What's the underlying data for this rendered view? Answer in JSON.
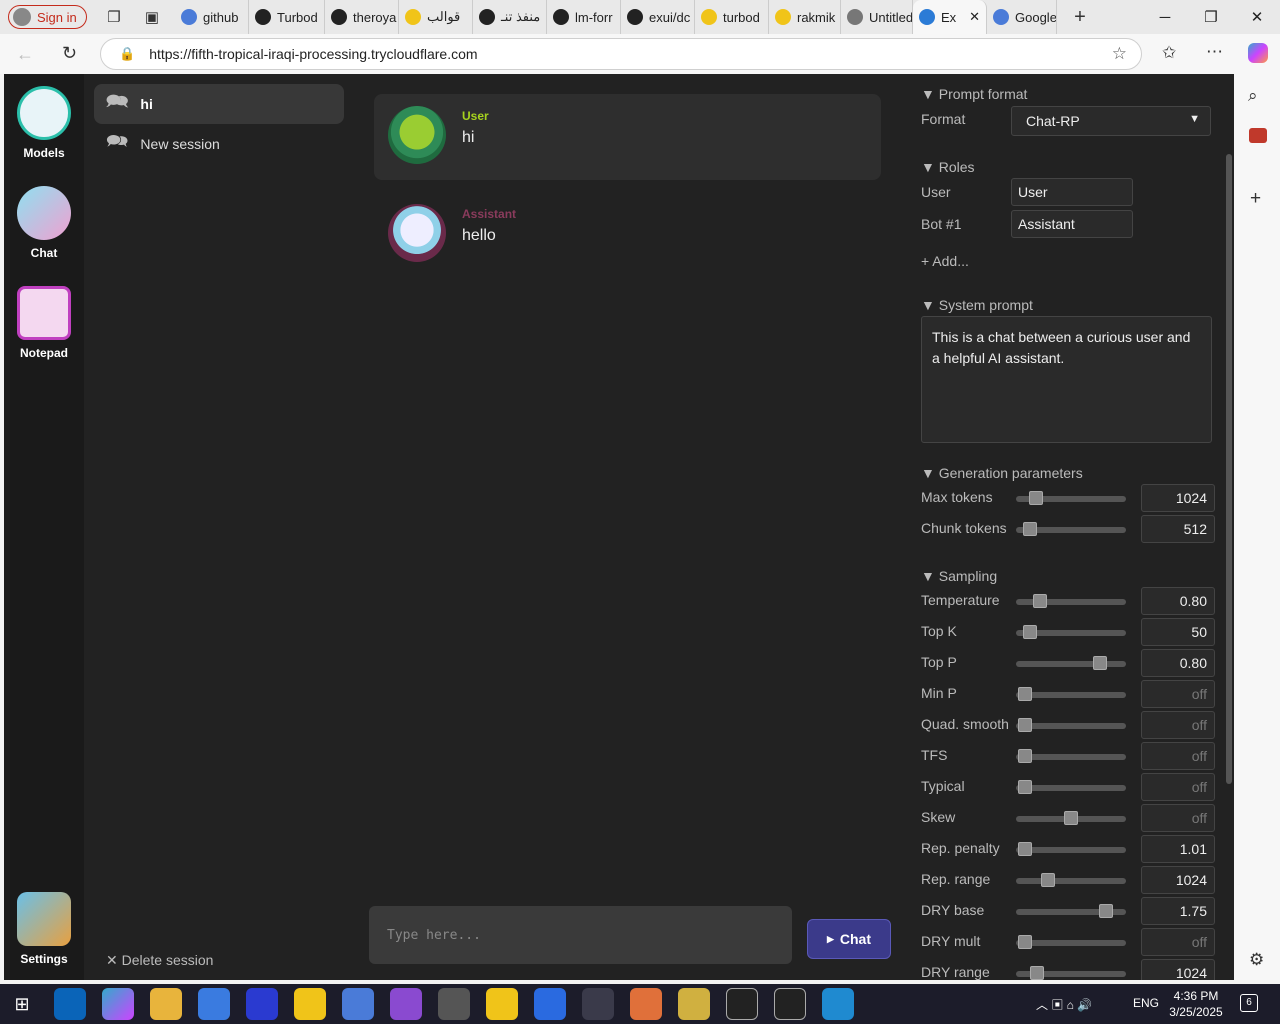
{
  "browser": {
    "signin": "Sign in",
    "tabs": [
      {
        "label": "github",
        "color": "#4a7bd8"
      },
      {
        "label": "Turbod",
        "color": "#222"
      },
      {
        "label": "theroya",
        "color": "#222"
      },
      {
        "label": "قوالب",
        "color": "#f0c419"
      },
      {
        "label": "منفذ تنـ",
        "color": "#222"
      },
      {
        "label": "lm-forr",
        "color": "#222"
      },
      {
        "label": "exui/dc",
        "color": "#222"
      },
      {
        "label": "turbod",
        "color": "#f0c419"
      },
      {
        "label": "rakmik",
        "color": "#f0c419"
      },
      {
        "label": "Untitled",
        "color": "#777"
      },
      {
        "label": "Ex",
        "color": "#2b7bd6",
        "active": true
      },
      {
        "label": "Google",
        "color": "#4a7bd8"
      }
    ],
    "url": "https://fifth-tropical-iraqi-processing.trycloudflare.com"
  },
  "rail": {
    "models": "Models",
    "chat": "Chat",
    "notepad": "Notepad",
    "settings": "Settings"
  },
  "sessions": {
    "items": [
      "hi",
      "New session"
    ],
    "delete": "✕ Delete session"
  },
  "chat": {
    "messages": [
      {
        "role": "User",
        "text": "hi",
        "color": "#a6d21e"
      },
      {
        "role": "Assistant",
        "text": "hello",
        "color": "#8a3b5c"
      }
    ],
    "placeholder": "Type here...",
    "send": "Chat"
  },
  "panel": {
    "prompt_format_title": "▼ Prompt format",
    "format_label": "Format",
    "format_value": "Chat-RP",
    "roles_title": "▼ Roles",
    "role_user_label": "User",
    "role_user_value": "User",
    "role_bot_label": "Bot #1",
    "role_bot_value": "Assistant",
    "add": "+ Add...",
    "system_title": "▼ System prompt",
    "system_text": "This is a chat between a curious user and a helpful AI assistant.",
    "gen_title": "▼ Generation parameters",
    "gen": [
      {
        "label": "Max tokens",
        "value": "1024",
        "level": 0.18
      },
      {
        "label": "Chunk tokens",
        "value": "512",
        "level": 0.13
      }
    ],
    "sampling_title": "▼ Sampling",
    "sampling": [
      {
        "label": "Temperature",
        "value": "0.80",
        "level": 0.22
      },
      {
        "label": "Top K",
        "value": "50",
        "level": 0.13
      },
      {
        "label": "Top P",
        "value": "0.80",
        "level": 0.76
      },
      {
        "label": "Min P",
        "value": "off",
        "level": 0.08
      },
      {
        "label": "Quad. smooth",
        "value": "off",
        "level": 0.08
      },
      {
        "label": "TFS",
        "value": "off",
        "level": 0.08
      },
      {
        "label": "Typical",
        "value": "off",
        "level": 0.08
      },
      {
        "label": "Skew",
        "value": "off",
        "level": 0.5
      },
      {
        "label": "Rep. penalty",
        "value": "1.01",
        "level": 0.08
      },
      {
        "label": "Rep. range",
        "value": "1024",
        "level": 0.29
      },
      {
        "label": "DRY base",
        "value": "1.75",
        "level": 0.82
      },
      {
        "label": "DRY mult",
        "value": "off",
        "level": 0.08
      },
      {
        "label": "DRY range",
        "value": "1024",
        "level": 0.19
      }
    ]
  },
  "taskbar": {
    "time": "4:36 PM",
    "date": "3/25/2025",
    "lang": "ENG",
    "notif": "6"
  }
}
